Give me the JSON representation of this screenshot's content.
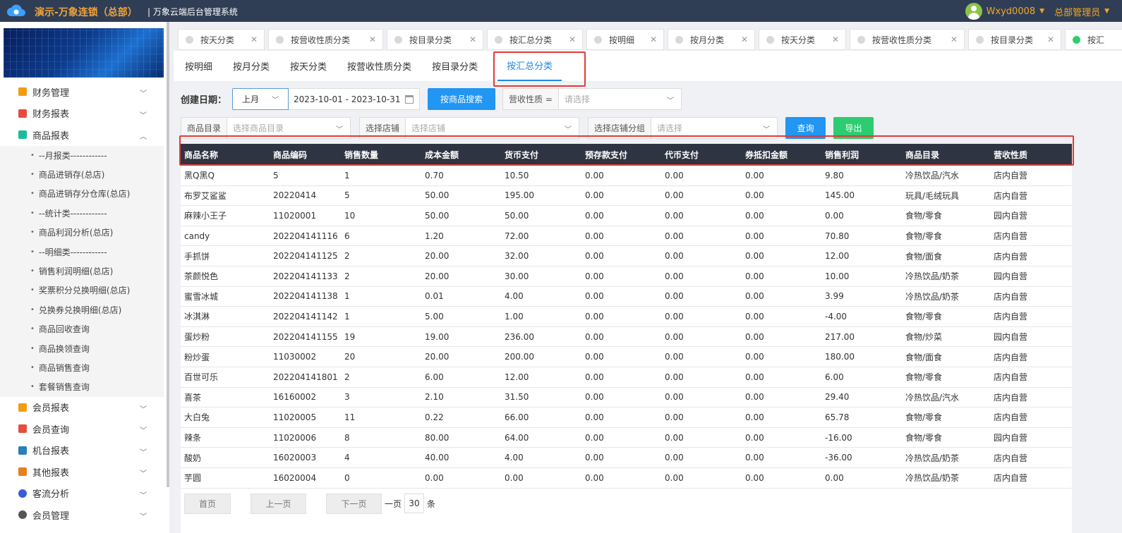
{
  "header": {
    "brand": "演示-万象连锁（总部）",
    "subtitle": "| 万象云端后台管理系统",
    "username": "Wxyd0008",
    "role": "总部管理员"
  },
  "sidebar": {
    "items": [
      {
        "label": "财务管理",
        "icon_color": "#f39c12"
      },
      {
        "label": "财务报表",
        "icon_color": "#e74c3c"
      },
      {
        "label": "商品报表",
        "icon_color": "#1abc9c"
      }
    ],
    "sub_items": [
      "--月报类------------",
      "商品进销存(总店)",
      "商品进销存分仓库(总店)",
      "--统计类------------",
      "商品利润分析(总店)",
      "--明细类------------",
      "销售利润明细(总店)",
      "奖票积分兑换明细(总店)",
      "兑换券兑换明细(总店)",
      "商品回收查询",
      "商品换领查询",
      "商品销售查询",
      "套餐销售查询"
    ],
    "items_after": [
      {
        "label": "会员报表",
        "icon_color": "#f39c12"
      },
      {
        "label": "会员查询",
        "icon_color": "#e74c3c"
      },
      {
        "label": "机台报表",
        "icon_color": "#2980b9"
      },
      {
        "label": "其他报表",
        "icon_color": "#e67e22"
      },
      {
        "label": "客流分析",
        "icon_color": "#3b5bdb"
      },
      {
        "label": "会员管理",
        "icon_color": "#555555"
      }
    ]
  },
  "tabs": [
    {
      "label": "按天分类",
      "active": false
    },
    {
      "label": "按营收性质分类",
      "active": false
    },
    {
      "label": "按目录分类",
      "active": false
    },
    {
      "label": "按汇总分类",
      "active": false
    },
    {
      "label": "按明细",
      "active": false
    },
    {
      "label": "按月分类",
      "active": false
    },
    {
      "label": "按天分类",
      "active": false
    },
    {
      "label": "按营收性质分类",
      "active": false
    },
    {
      "label": "按目录分类",
      "active": false
    },
    {
      "label": "按汇",
      "active": true
    }
  ],
  "subtabs": [
    {
      "label": "按明细",
      "active": false
    },
    {
      "label": "按月分类",
      "active": false
    },
    {
      "label": "按天分类",
      "active": false
    },
    {
      "label": "按营收性质分类",
      "active": false
    },
    {
      "label": "按目录分类",
      "active": false
    },
    {
      "label": "按汇总分类",
      "active": true
    }
  ],
  "filters": {
    "date_label": "创建日期：",
    "period_value": "上月",
    "date_range": "2023-10-01 - 2023-10-31",
    "search_by_product": "按商品搜索",
    "revenue_prefix": "营收性质 =",
    "revenue_placeholder": "请选择",
    "catalog_prefix": "商品目录",
    "catalog_placeholder": "选择商品目录",
    "store_prefix": "选择店铺",
    "store_placeholder": "选择店铺",
    "store_group_prefix": "选择店铺分组",
    "store_group_placeholder": "请选择",
    "query": "查询",
    "export": "导出"
  },
  "table": {
    "columns": [
      "商品名称",
      "商品编码",
      "销售数量",
      "成本金额",
      "货币支付",
      "预存款支付",
      "代币支付",
      "券抵扣金额",
      "销售利润",
      "商品目录",
      "营收性质"
    ],
    "rows": [
      [
        "黑Q黑Q",
        "5",
        "1",
        "0.70",
        "10.50",
        "0.00",
        "0.00",
        "0.00",
        "9.80",
        "冷热饮品/汽水",
        "店内自营"
      ],
      [
        "布罗艾鲨鲨",
        "20220414",
        "5",
        "50.00",
        "195.00",
        "0.00",
        "0.00",
        "0.00",
        "145.00",
        "玩具/毛绒玩具",
        "店内自营"
      ],
      [
        "麻辣小王子",
        "11020001",
        "10",
        "50.00",
        "50.00",
        "0.00",
        "0.00",
        "0.00",
        "0.00",
        "食物/零食",
        "园内自营"
      ],
      [
        "candy",
        "202204141116",
        "6",
        "1.20",
        "72.00",
        "0.00",
        "0.00",
        "0.00",
        "70.80",
        "食物/零食",
        "店内自营"
      ],
      [
        "手抓饼",
        "202204141125",
        "2",
        "20.00",
        "32.00",
        "0.00",
        "0.00",
        "0.00",
        "12.00",
        "食物/面食",
        "店内自营"
      ],
      [
        "茶颜悦色",
        "202204141133",
        "2",
        "20.00",
        "30.00",
        "0.00",
        "0.00",
        "0.00",
        "10.00",
        "冷热饮品/奶茶",
        "园内自营"
      ],
      [
        "蜜雪冰城",
        "202204141138",
        "1",
        "0.01",
        "4.00",
        "0.00",
        "0.00",
        "0.00",
        "3.99",
        "冷热饮品/奶茶",
        "店内自营"
      ],
      [
        "冰淇淋",
        "202204141142",
        "1",
        "5.00",
        "1.00",
        "0.00",
        "0.00",
        "0.00",
        "-4.00",
        "食物/零食",
        "店内自营"
      ],
      [
        "蛋炒粉",
        "202204141155",
        "19",
        "19.00",
        "236.00",
        "0.00",
        "0.00",
        "0.00",
        "217.00",
        "食物/炒菜",
        "园内自营"
      ],
      [
        "粉炒蛋",
        "11030002",
        "20",
        "20.00",
        "200.00",
        "0.00",
        "0.00",
        "0.00",
        "180.00",
        "食物/面食",
        "店内自营"
      ],
      [
        "百世可乐",
        "202204141801",
        "2",
        "6.00",
        "12.00",
        "0.00",
        "0.00",
        "0.00",
        "6.00",
        "食物/零食",
        "店内自营"
      ],
      [
        "喜茶",
        "16160002",
        "3",
        "2.10",
        "31.50",
        "0.00",
        "0.00",
        "0.00",
        "29.40",
        "冷热饮品/汽水",
        "店内自营"
      ],
      [
        "大白兔",
        "11020005",
        "11",
        "0.22",
        "66.00",
        "0.00",
        "0.00",
        "0.00",
        "65.78",
        "食物/零食",
        "店内自营"
      ],
      [
        "辣条",
        "11020006",
        "8",
        "80.00",
        "64.00",
        "0.00",
        "0.00",
        "0.00",
        "-16.00",
        "食物/零食",
        "园内自营"
      ],
      [
        "酸奶",
        "16020003",
        "4",
        "40.00",
        "4.00",
        "0.00",
        "0.00",
        "0.00",
        "-36.00",
        "冷热饮品/奶茶",
        "店内自营"
      ],
      [
        "芋圆",
        "16020004",
        "0",
        "0.00",
        "0.00",
        "0.00",
        "0.00",
        "0.00",
        "0.00",
        "冷热饮品/奶茶",
        "店内自营"
      ]
    ]
  },
  "pager": {
    "first": "首页",
    "prev": "上一页",
    "next": "下一页",
    "per_page_label": "一页",
    "per_page_value": "30",
    "unit": "条"
  }
}
